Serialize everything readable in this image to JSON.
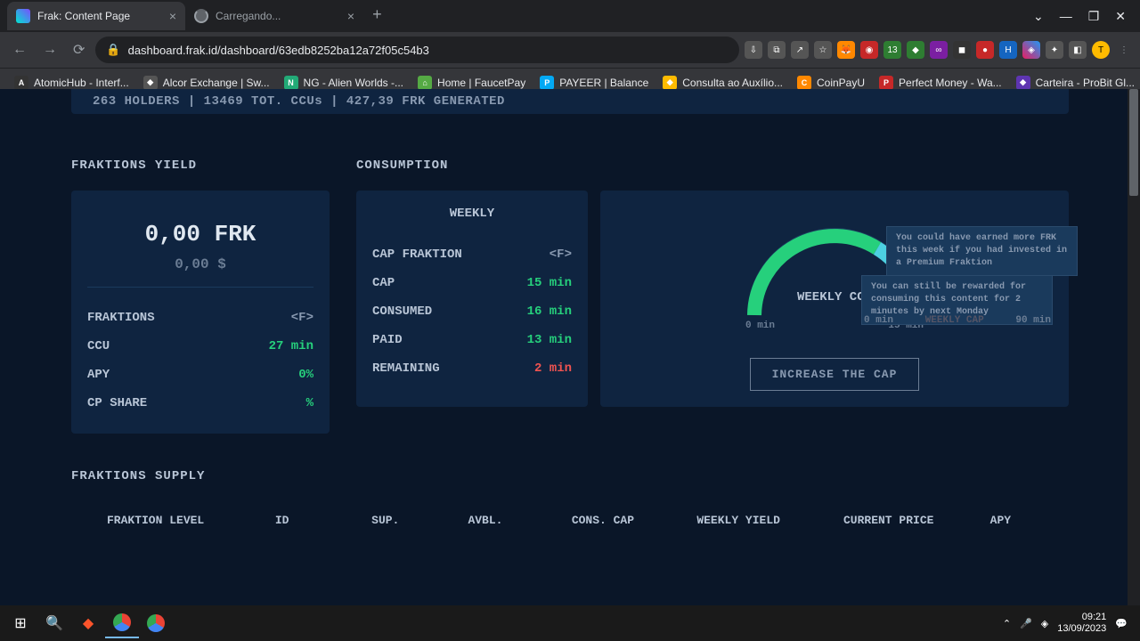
{
  "browser": {
    "tabs": [
      {
        "title": "Frak: Content Page",
        "active": true
      },
      {
        "title": "Carregando...",
        "active": false
      }
    ],
    "url_display": "dashboard.frak.id/dashboard/63edb8252ba12a72f05c54b3",
    "bookmarks": [
      {
        "label": "AtomicHub - Interf...",
        "color": "#333"
      },
      {
        "label": "Alcor Exchange | Sw...",
        "color": "#555"
      },
      {
        "label": "NG - Alien Worlds -...",
        "color": "#2a7"
      },
      {
        "label": "Home | FaucetPay",
        "color": "#5a4"
      },
      {
        "label": "PAYEER | Balance",
        "color": "#03a9f4",
        "badge": "P"
      },
      {
        "label": "Consulta ao Auxílio...",
        "color": "#fb0"
      },
      {
        "label": "CoinPayU",
        "color": "#f80"
      },
      {
        "label": "Perfect Money - Wa...",
        "color": "#c62828"
      },
      {
        "label": "Carteira - ProBit Gl...",
        "color": "#5e35b1"
      }
    ]
  },
  "stats_banner": {
    "holders": "263 HOLDERS",
    "ccus": "13469 TOT. CCUs",
    "generated": "427,39 FRK GENERATED",
    "sep": " | "
  },
  "yield": {
    "title": "FRAKTIONS YIELD",
    "frk": "0,00 FRK",
    "usd": "0,00 $",
    "rows": {
      "fraktions_label": "FRAKTIONS",
      "fraktions_val": "<F>",
      "ccu_label": "CCU",
      "ccu_val": "27 min",
      "apy_label": "APY",
      "apy_val": "0%",
      "cp_label": "CP SHARE",
      "cp_val": "%"
    }
  },
  "consumption": {
    "title": "CONSUMPTION",
    "weekly_title": "WEEKLY",
    "rows": {
      "capfrak_label": "CAP FRAKTION",
      "capfrak_val": "<F>",
      "cap_label": "CAP",
      "cap_val": "15 min",
      "consumed_label": "CONSUMED",
      "consumed_val": "16 min",
      "paid_label": "PAID",
      "paid_val": "13 min",
      "remaining_label": "REMAINING",
      "remaining_val": "2 min"
    },
    "gauge": {
      "label": "WEEKLY CCU",
      "tick_min": "0 min",
      "tick_max": "15 min",
      "back_label": "WEEKLY CAP",
      "back_min": "0 min",
      "back_max": "90 min"
    },
    "tooltip1": "You could have earned more FRK this week if you had invested in a Premium Fraktion",
    "tooltip2": "You can still be rewarded for consuming this content for 2 minutes by next Monday",
    "increase_btn": "INCREASE THE CAP"
  },
  "supply": {
    "title": "FRAKTIONS SUPPLY",
    "headers": [
      "FRAKTION LEVEL",
      "ID",
      "SUP.",
      "AVBL.",
      "CONS. CAP",
      "WEEKLY YIELD",
      "CURRENT PRICE",
      "APY"
    ]
  },
  "taskbar": {
    "time": "09:21",
    "date": "13/09/2023"
  }
}
